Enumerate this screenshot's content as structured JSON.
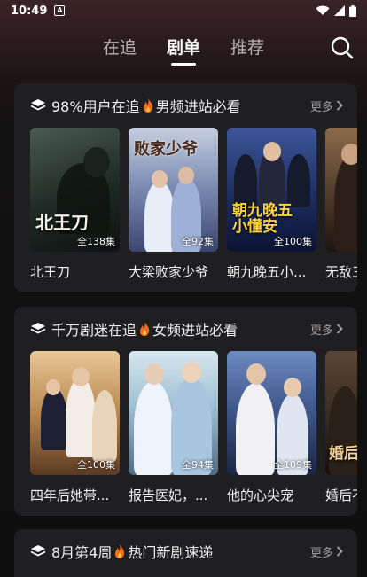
{
  "status": {
    "time": "10:49",
    "notif_glyph": "A"
  },
  "nav": {
    "tabs": [
      {
        "label": "在追",
        "active": false
      },
      {
        "label": "剧单",
        "active": true
      },
      {
        "label": "推荐",
        "active": false
      }
    ],
    "search_icon": "search-icon"
  },
  "sections": [
    {
      "title_pre": "98%用户在追",
      "title_post": "男频进站必看",
      "more": "更多",
      "items": [
        {
          "title": "北王刀",
          "episodes": "全138集",
          "poster_text": "北王刀",
          "colors": [
            "#3b4a44",
            "#121815"
          ]
        },
        {
          "title": "大梁败家少爷",
          "episodes": "全92集",
          "poster_text": "败家少爷",
          "colors": [
            "#7a88a8",
            "#2d3558"
          ]
        },
        {
          "title": "朝九晚五小...",
          "episodes": "全100集",
          "poster_text": "朝九晚五 小懂安",
          "colors": [
            "#2c3f73",
            "#101a3a"
          ]
        },
        {
          "title": "无敌三",
          "episodes": "",
          "poster_text": "",
          "colors": [
            "#8a6a4a",
            "#2c2018"
          ]
        }
      ]
    },
    {
      "title_pre": "千万剧迷在追",
      "title_post": "女频进站必看",
      "more": "更多",
      "items": [
        {
          "title": "四年后她带...",
          "episodes": "全100集",
          "poster_text": "",
          "colors": [
            "#c79b63",
            "#5b3a22"
          ]
        },
        {
          "title": "报告医妃，...",
          "episodes": "全94集",
          "poster_text": "",
          "colors": [
            "#a9c6d6",
            "#4d6c86"
          ]
        },
        {
          "title": "他的心尖宠",
          "episodes": "全109集",
          "poster_text": "",
          "colors": [
            "#4f6fa4",
            "#1b2544"
          ]
        },
        {
          "title": "婚后不",
          "episodes": "",
          "poster_text": "婚后",
          "colors": [
            "#6a5340",
            "#201812"
          ]
        }
      ]
    },
    {
      "title_pre": "8月第4周",
      "title_post": "热门新剧速递",
      "more": "更多",
      "items": []
    }
  ],
  "colors": {
    "accent_flame": "#f26b1d",
    "card_bg": "#1f1e20",
    "page_bg": "#0f0f10"
  }
}
